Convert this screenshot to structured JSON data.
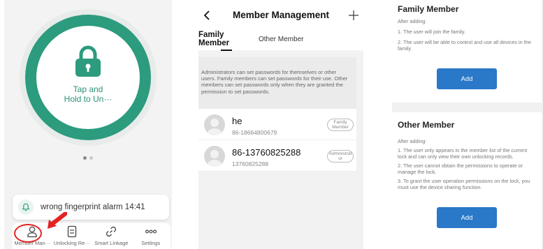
{
  "lock_screen": {
    "tap_line1": "Tap and",
    "tap_line2": "Hold to Un···",
    "alarm_text": "wrong fingerprint alarm 14:41",
    "tabs": [
      {
        "label": "Member Man···",
        "icon": "person-icon"
      },
      {
        "label": "Unlocking Re···",
        "icon": "record-icon"
      },
      {
        "label": "Smart Linkage",
        "icon": "link-icon"
      },
      {
        "label": "Settings",
        "icon": "more-icon"
      }
    ],
    "accent_color": "#2c9b7e"
  },
  "member_management": {
    "title": "Member Management",
    "seg_family_line1": "Family",
    "seg_family_line2": "Member",
    "seg_other": "Other Member",
    "notice": "Administrators can set passwords for themselves or other users. Family members can set passwords for their use. Other members can set passwords only when they are granted the permission to set passwords.",
    "members": [
      {
        "name": "he",
        "phone": "86-18664800679",
        "role": "Family Member"
      },
      {
        "name": "86-13760825288",
        "phone": "13760825288",
        "role": "Administrat or"
      }
    ]
  },
  "info": {
    "family": {
      "title": "Family Member",
      "lead": "After adding:",
      "points": [
        "1. The user will join the family.",
        "2. The user will be able to control and use all devices in the family."
      ],
      "button": "Add"
    },
    "other": {
      "title": "Other Member",
      "lead": "After adding:",
      "points": [
        "1. The user only appears in the member list of the current lock and can only view their own unlocking records.",
        "2. The user cannot obtain the permissions to operate or manage the lock.",
        "3. To grant the user operation permissions on the lock, you must use the device sharing function."
      ],
      "button": "Add"
    },
    "button_color": "#2a78c8"
  }
}
